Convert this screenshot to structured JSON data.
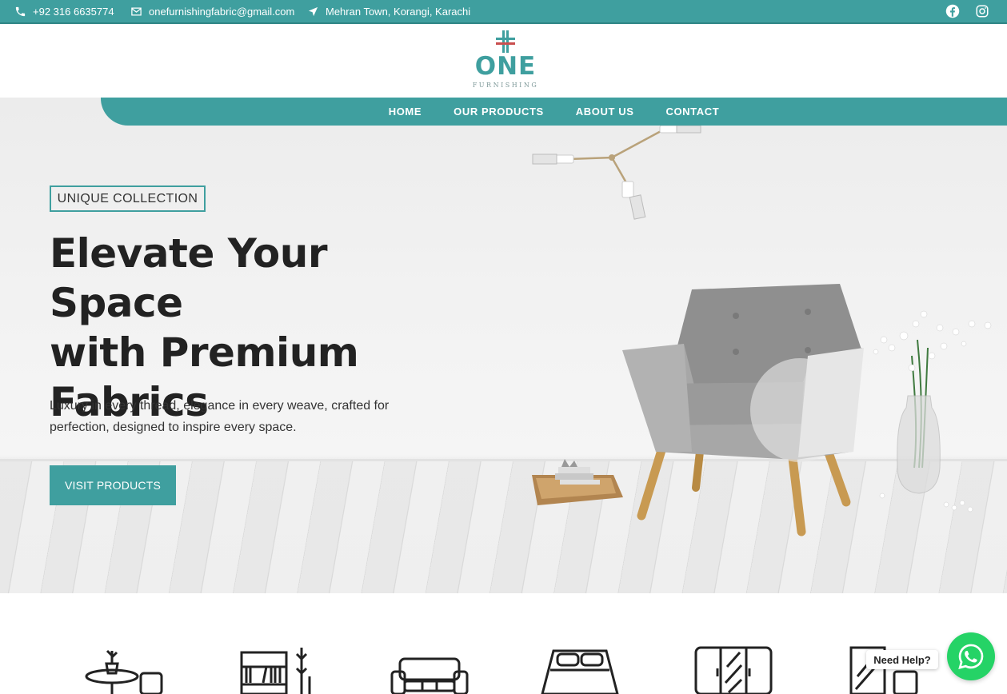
{
  "topbar": {
    "phone": "+92 316 6635774",
    "email": "onefurnishingfabric@gmail.com",
    "address": "Mehran Town, Korangi, Karachi",
    "social": [
      "facebook-icon",
      "instagram-icon"
    ]
  },
  "logo": {
    "word": "ONE",
    "sub": "FURNISHING"
  },
  "nav": {
    "items": [
      "HOME",
      "OUR PRODUCTS",
      "ABOUT US",
      "CONTACT"
    ]
  },
  "hero": {
    "badge": "UNIQUE COLLECTION",
    "headline_line1": "Elevate Your Space",
    "headline_line2": "with Premium",
    "headline_line3": "Fabrics",
    "subtext": "Luxury in every thread, elegance in every weave, crafted for perfection, designed to inspire every space.",
    "cta": "VISIT PRODUCTS"
  },
  "categories": [
    "side-table-icon",
    "bookshelf-icon",
    "sofa-icon",
    "bed-icon",
    "wardrobe-icon",
    "dresser-icon"
  ],
  "whatsapp": {
    "help_label": "Need Help?"
  },
  "colors": {
    "accent": "#3f9f9f",
    "whatsapp": "#25d366",
    "text": "#222222"
  }
}
